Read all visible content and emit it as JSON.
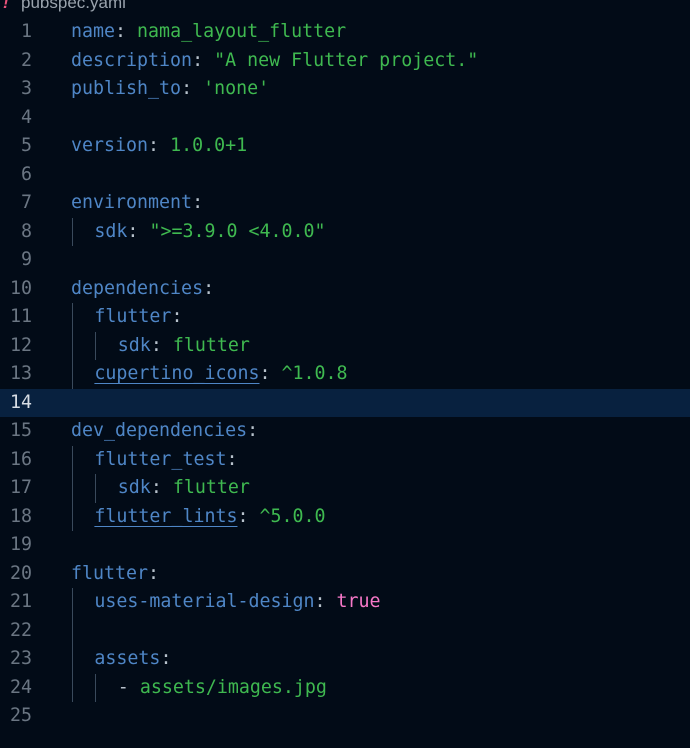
{
  "tab": {
    "icon": "!",
    "filename": "pubspec.yaml"
  },
  "lines": [
    {
      "n": "1",
      "indent": 0,
      "key": "name",
      "sep": ": ",
      "val": "nama_layout_flutter",
      "vt": "s"
    },
    {
      "n": "2",
      "indent": 0,
      "key": "description",
      "sep": ": ",
      "val": "\"A new Flutter project.\"",
      "vt": "s"
    },
    {
      "n": "3",
      "indent": 0,
      "key": "publish_to",
      "sep": ": ",
      "val": "'none'",
      "vt": "s"
    },
    {
      "n": "4",
      "indent": 0
    },
    {
      "n": "5",
      "indent": 0,
      "key": "version",
      "sep": ": ",
      "val": "1.0.0+1",
      "vt": "s"
    },
    {
      "n": "6",
      "indent": 0
    },
    {
      "n": "7",
      "indent": 0,
      "key": "environment",
      "sep": ":"
    },
    {
      "n": "8",
      "indent": 1,
      "key": "sdk",
      "sep": ": ",
      "val": "\">=3.9.0 <4.0.0\"",
      "vt": "s"
    },
    {
      "n": "9",
      "indent": 0
    },
    {
      "n": "10",
      "indent": 0,
      "key": "dependencies",
      "sep": ":"
    },
    {
      "n": "11",
      "indent": 1,
      "key": "flutter",
      "sep": ":"
    },
    {
      "n": "12",
      "indent": 2,
      "key": "sdk",
      "sep": ": ",
      "val": "flutter",
      "vt": "s"
    },
    {
      "n": "13",
      "indent": 1,
      "key": "cupertino_icons",
      "sep": ": ",
      "val": "^1.0.8",
      "vt": "s",
      "underline": true
    },
    {
      "n": "14",
      "indent": 0,
      "current": true
    },
    {
      "n": "15",
      "indent": 0,
      "key": "dev_dependencies",
      "sep": ":"
    },
    {
      "n": "16",
      "indent": 1,
      "key": "flutter_test",
      "sep": ":"
    },
    {
      "n": "17",
      "indent": 2,
      "key": "sdk",
      "sep": ": ",
      "val": "flutter",
      "vt": "s"
    },
    {
      "n": "18",
      "indent": 1,
      "key": "flutter_lints",
      "sep": ": ",
      "val": "^5.0.0",
      "vt": "s",
      "underline": true
    },
    {
      "n": "19",
      "indent": 0
    },
    {
      "n": "20",
      "indent": 0,
      "key": "flutter",
      "sep": ":"
    },
    {
      "n": "21",
      "indent": 1,
      "key": "uses-material-design",
      "sep": ": ",
      "val": "true",
      "vt": "b"
    },
    {
      "n": "22",
      "indent": 1
    },
    {
      "n": "23",
      "indent": 1,
      "key": "assets",
      "sep": ":"
    },
    {
      "n": "24",
      "indent": 2,
      "dash": "- ",
      "val": "assets/images.jpg",
      "vt": "s"
    },
    {
      "n": "25",
      "indent": 0
    }
  ],
  "colors": {
    "background": "#020b17",
    "current_line": "#08213f",
    "key": "#4f86c6",
    "string": "#3fb950",
    "boolean": "#f778c8"
  }
}
